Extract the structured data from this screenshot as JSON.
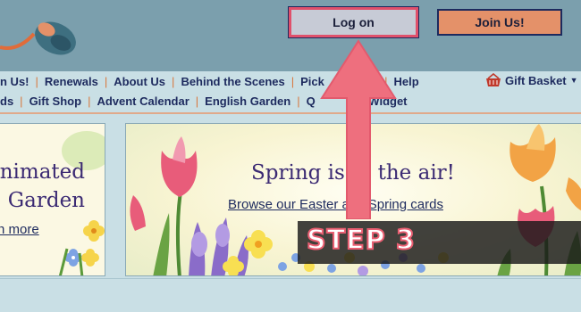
{
  "colors": {
    "header_bg": "#7b9fad",
    "nav_bg": "#c9dfe5",
    "link": "#1d2a5e",
    "separator": "#d9783e",
    "join_button": "#e49169",
    "login_button": "#c7cbd6",
    "highlight_red": "#ea5f72"
  },
  "header": {
    "login_label": "Log on",
    "join_label": "Join Us!",
    "logo_icon": "computer-mouse-icon"
  },
  "nav": {
    "row1": [
      "n Us!",
      "Renewals",
      "About Us",
      "Behind the Scenes",
      "Pick",
      "ard",
      "Help"
    ],
    "row2": [
      "ds",
      "Gift Shop",
      "Advent Calendar",
      "English Garden",
      "Q",
      "d Widget"
    ],
    "gift_basket": "Gift Basket",
    "gift_basket_icon": "shopping-basket-icon",
    "caret_icon": "caret-down-icon"
  },
  "left_banner": {
    "title_line1": "nimated",
    "title_line2": "Garden",
    "link": "n more"
  },
  "main_banner": {
    "title": "Spring is in the air!",
    "link": "Browse our Easter and Spring cards"
  },
  "overlay": {
    "step": "STEP 3",
    "arrow_icon": "arrow-up-icon"
  }
}
